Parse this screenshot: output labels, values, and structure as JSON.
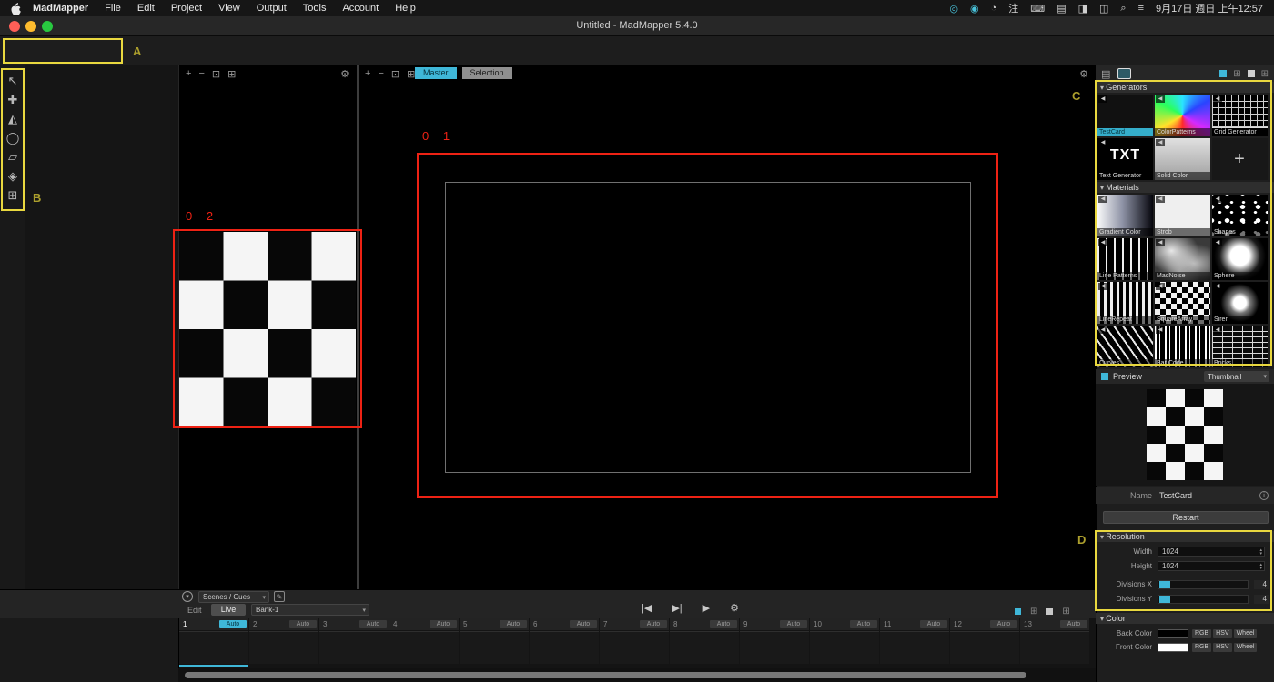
{
  "colors": {
    "accent": "#3fb7d8",
    "annotation_yellow": "#e9d83f",
    "annotation_red": "#ee2214"
  },
  "menu_bar": {
    "app_name": "MadMapper",
    "items": [
      "File",
      "Edit",
      "Project",
      "View",
      "Output",
      "Tools",
      "Account",
      "Help"
    ],
    "status_icons": [
      {
        "name": "record-status-icon",
        "glyph": "◎",
        "teal": true
      },
      {
        "name": "camera-status-icon",
        "glyph": "◉",
        "teal": true
      },
      {
        "name": "play-status-icon",
        "glyph": "◔",
        "teal": false
      },
      {
        "name": "input-method-icon",
        "glyph": "注",
        "teal": false
      },
      {
        "name": "keyboard-icon",
        "glyph": "⌨",
        "teal": false
      },
      {
        "name": "display-icon",
        "glyph": "▤",
        "teal": false
      },
      {
        "name": "battery-icon",
        "glyph": "◨",
        "teal": false
      },
      {
        "name": "control-center-icon",
        "glyph": "◫",
        "teal": false
      },
      {
        "name": "spotlight-icon",
        "glyph": "⌕",
        "teal": false
      },
      {
        "name": "menu-list-icon",
        "glyph": "≡",
        "teal": false
      }
    ],
    "clock": "9月17日 週日 上午12:57"
  },
  "title_bar": {
    "title": "Untitled - MadMapper 5.4.0"
  },
  "annotations": {
    "label_a": "A",
    "label_b": "B",
    "label_c": "C",
    "label_d": "D",
    "region_01": "0 1",
    "region_02": "0 2"
  },
  "toolbar": {
    "tools": [
      {
        "name": "surfaces-mode-icon",
        "glyph": "▣",
        "active": true
      },
      {
        "name": "fixtures-mode-icon",
        "glyph": "☼",
        "active": false
      },
      {
        "name": "outputs-mode-icon",
        "glyph": "⊟",
        "active": false
      },
      {
        "name": "modules-mode-icon",
        "glyph": "❖",
        "active": false
      },
      {
        "name": "settings-gear-icon",
        "glyph": "⚙",
        "active": false
      }
    ],
    "pause_glyph": "Ⅱ",
    "blackout1_glyph": "Ⅰ",
    "blackout2_glyph": "Ⅰ",
    "reset_glyph": "↷",
    "right": {
      "n_glyph": "∩",
      "eye_glyph": "◉",
      "dropdown_value": "",
      "dropdown_arrow": "▾",
      "undo_glyph": "↶",
      "redo_glyph": "↷"
    }
  },
  "side_tools": [
    {
      "name": "select-tool-icon",
      "glyph": "↖"
    },
    {
      "name": "move-tool-icon",
      "glyph": "✚"
    },
    {
      "name": "triangle-surface-tool-icon",
      "glyph": "◭"
    },
    {
      "name": "circle-surface-tool-icon",
      "glyph": "◯"
    },
    {
      "name": "quad-surface-tool-icon",
      "glyph": "▱"
    },
    {
      "name": "mesh-warp-tool-icon",
      "glyph": "◈"
    },
    {
      "name": "add-surface-tool-icon",
      "glyph": "⊞"
    }
  ],
  "canvas": {
    "zoom_icons": [
      "+",
      "−",
      "⊡",
      "⊞"
    ],
    "gear": "⚙",
    "tabs": [
      {
        "label": "Master",
        "active": true
      },
      {
        "label": "Selection",
        "active": false
      }
    ]
  },
  "library_panel": {
    "generators_header": "Generators",
    "materials_header": "Materials",
    "generators": [
      {
        "name": "generator-testcard",
        "label": "TestCard",
        "tex": "checker",
        "selected": true
      },
      {
        "name": "generator-colorpatterns",
        "label": "ColorPatterns",
        "tex": "rainbow"
      },
      {
        "name": "generator-grid",
        "label": "Grid Generator",
        "tex": "grid",
        "boxed": true
      },
      {
        "name": "generator-text",
        "label": "Text Generator",
        "tex": "txt",
        "text": "TXT"
      },
      {
        "name": "generator-solid-color",
        "label": "Solid Color",
        "tex": "solid"
      },
      {
        "name": "add-generator-tile",
        "label": "",
        "tex": "plus",
        "text": "+",
        "plus": true
      }
    ],
    "materials": [
      {
        "name": "material-gradient-color",
        "label": "Gradient Color",
        "tex": "gradient"
      },
      {
        "name": "material-strob",
        "label": "Strob",
        "tex": "strob"
      },
      {
        "name": "material-shapes",
        "label": "Shapes",
        "tex": "shapes"
      },
      {
        "name": "material-line-patterns",
        "label": "Line Patterns",
        "tex": "linepatterns"
      },
      {
        "name": "material-madnoise",
        "label": "MadNoise",
        "tex": "madnoise"
      },
      {
        "name": "material-sphere",
        "label": "Sphere",
        "tex": "sphere"
      },
      {
        "name": "material-linerepeat",
        "label": "LineRepeat",
        "tex": "linerepeat"
      },
      {
        "name": "material-squarearray",
        "label": "SquareArray",
        "tex": "squarearray"
      },
      {
        "name": "material-siren",
        "label": "Siren",
        "tex": "siren"
      },
      {
        "name": "material-curves",
        "label": "Curves",
        "tex": "curves"
      },
      {
        "name": "material-bar-code",
        "label": "Bar Code",
        "tex": "barcode"
      },
      {
        "name": "material-bricks",
        "label": "Bricks",
        "tex": "bricks"
      }
    ]
  },
  "preview": {
    "label": "Preview",
    "mode": "Thumbnail",
    "arrow": "▾",
    "name_label": "Name",
    "name_value": "TestCard",
    "info": "i",
    "restart": "Restart"
  },
  "resolution": {
    "header": "Resolution",
    "width_label": "Width",
    "width_value": "1024",
    "height_label": "Height",
    "height_value": "1024",
    "div_x_label": "Divisions X",
    "div_x_value": "4",
    "div_y_label": "Divisions Y",
    "div_y_value": "4"
  },
  "color": {
    "header": "Color",
    "back_label": "Back Color",
    "front_label": "Front Color",
    "back_hex": "#000000",
    "front_hex": "#ffffff",
    "buttons": [
      "RGB",
      "HSV",
      "Wheel"
    ]
  },
  "bottom_bar": {
    "scenes_cues": "Scenes / Cues",
    "arrow": "▾",
    "edit": "Edit",
    "live": "Live",
    "bank": "Bank-1",
    "transport": [
      {
        "name": "skip-back-icon",
        "glyph": "|◀"
      },
      {
        "name": "skip-forward-icon",
        "glyph": "▶|"
      },
      {
        "name": "play-icon",
        "glyph": "▶"
      },
      {
        "name": "transport-settings-icon",
        "glyph": "⚙"
      }
    ]
  },
  "scenes": [
    {
      "num": "1",
      "mode": "Auto",
      "active": true
    },
    {
      "num": "2",
      "mode": "Auto",
      "active": false
    },
    {
      "num": "3",
      "mode": "Auto",
      "active": false
    },
    {
      "num": "4",
      "mode": "Auto",
      "active": false
    },
    {
      "num": "5",
      "mode": "Auto",
      "active": false
    },
    {
      "num": "6",
      "mode": "Auto",
      "active": false
    },
    {
      "num": "7",
      "mode": "Auto",
      "active": false
    },
    {
      "num": "8",
      "mode": "Auto",
      "active": false
    },
    {
      "num": "9",
      "mode": "Auto",
      "active": false
    },
    {
      "num": "10",
      "mode": "Auto",
      "active": false
    },
    {
      "num": "11",
      "mode": "Auto",
      "active": false
    },
    {
      "num": "12",
      "mode": "Auto",
      "active": false
    },
    {
      "num": "13",
      "mode": "Auto",
      "active": false
    }
  ]
}
